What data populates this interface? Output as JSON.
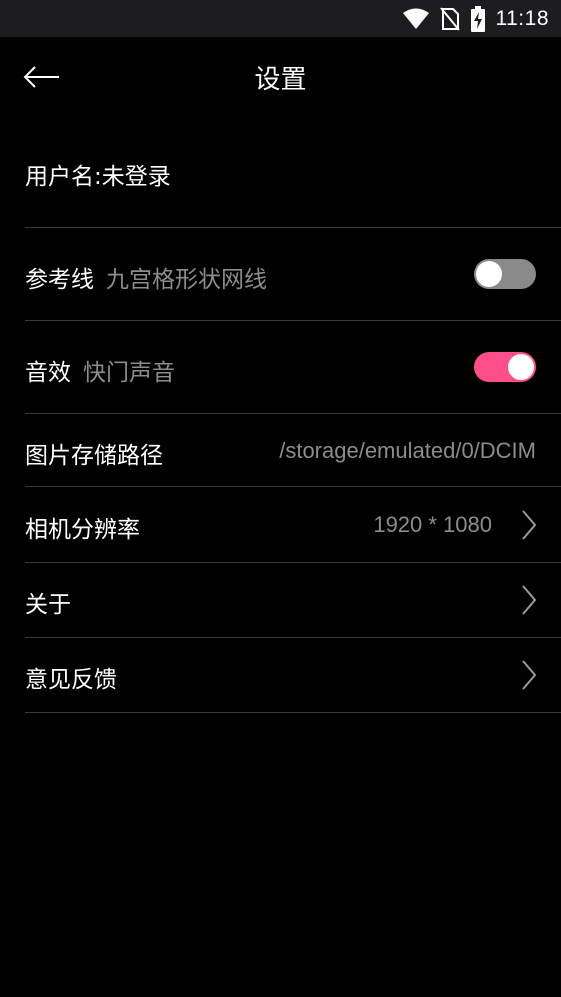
{
  "status_bar": {
    "time": "11:18",
    "icons": [
      "wifi-icon",
      "no-sim-icon",
      "battery-charging-icon"
    ]
  },
  "header": {
    "title": "设置",
    "back_icon": "arrow-left-icon"
  },
  "settings": {
    "username": {
      "label": "用户名:未登录"
    },
    "grid_lines": {
      "label": "参考线",
      "sub": "九宫格形状网线",
      "enabled": false
    },
    "shutter_sound": {
      "label": "音效",
      "sub": "快门声音",
      "enabled": true
    },
    "storage_path": {
      "label": "图片存储路径",
      "value": "/storage/emulated/0/DCIM"
    },
    "resolution": {
      "label": "相机分辨率",
      "value": "1920 * 1080"
    },
    "about": {
      "label": "关于"
    },
    "feedback": {
      "label": "意见反馈"
    }
  },
  "colors": {
    "background": "#000000",
    "status_bar": "#1d1d1f",
    "accent": "#ff4f8b",
    "toggle_off": "#8a8a8a",
    "secondary_text": "#8c8c8c",
    "divider": "#3a3a3a"
  }
}
